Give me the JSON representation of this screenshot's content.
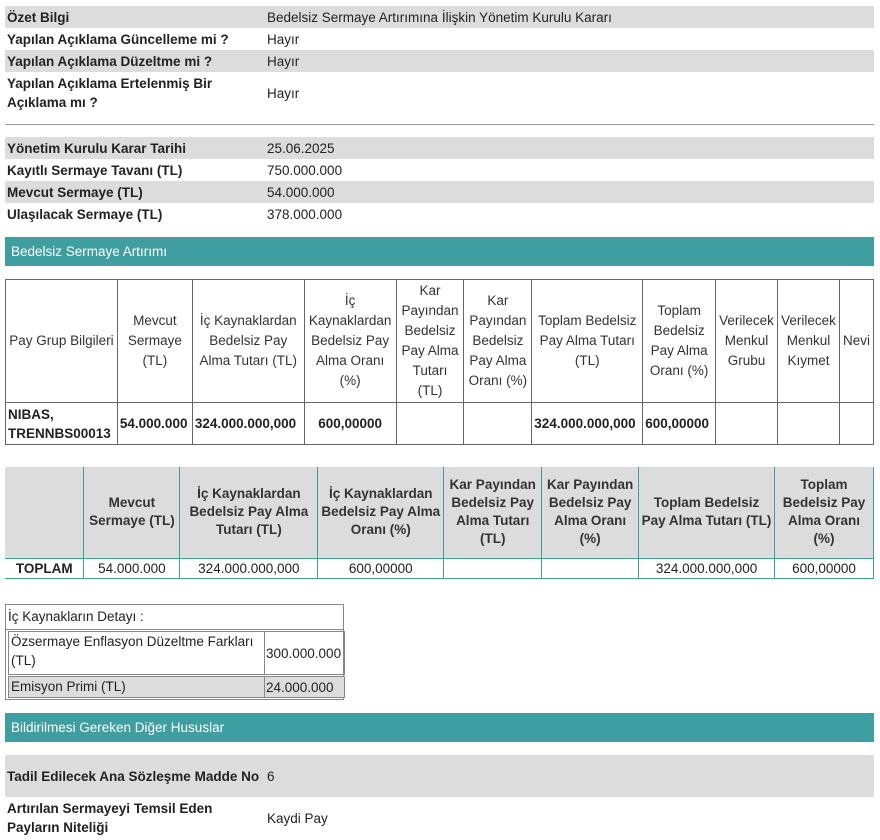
{
  "summary": [
    {
      "key": "Özet Bilgi",
      "value": "Bedelsiz Sermaye Artırımına İlişkin Yönetim Kurulu Kararı",
      "alt": true
    },
    {
      "key": "Yapılan Açıklama Güncelleme mi ?",
      "value": "Hayır",
      "alt": false
    },
    {
      "key": "Yapılan Açıklama Düzeltme mi ?",
      "value": "Hayır",
      "alt": true
    },
    {
      "key": "Yapılan Açıklama Ertelenmiş Bir Açıklama mı ?",
      "value": "Hayır",
      "alt": false
    }
  ],
  "board": [
    {
      "key": "Yönetim Kurulu Karar Tarihi",
      "value": "25.06.2025",
      "alt": true
    },
    {
      "key": "Kayıtlı Sermaye Tavanı (TL)",
      "value": "750.000.000",
      "alt": false
    },
    {
      "key": "Mevcut Sermaye (TL)",
      "value": "54.000.000",
      "alt": true
    },
    {
      "key": "Ulaşılacak Sermaye (TL)",
      "value": "378.000.000",
      "alt": false
    }
  ],
  "section1_title": "Bedelsiz Sermaye Artırımı",
  "table1": {
    "headers": [
      "Pay Grup Bilgileri",
      "Mevcut Sermaye (TL)",
      "İç Kaynaklardan Bedelsiz Pay Alma Tutarı (TL)",
      "İç Kaynaklardan Bedelsiz Pay Alma Oranı (%)",
      "Kar Payından Bedelsiz Pay Alma Tutarı (TL)",
      "Kar Payından Bedelsiz Pay Alma Oranı (%)",
      "Toplam Bedelsiz Pay Alma Tutarı (TL)",
      "Toplam Bedelsiz Pay Alma Oranı (%)",
      "Verilecek Menkul Grubu",
      "Verilecek Menkul Kıymet",
      "Nevi"
    ],
    "row": [
      "NIBAS, TRENNBS00013",
      "54.000.000",
      "324.000.000,000",
      "600,00000",
      "",
      "",
      "324.000.000,000",
      "600,00000",
      "",
      "",
      ""
    ]
  },
  "table2": {
    "headers": [
      "",
      "Mevcut Sermaye (TL)",
      "İç Kaynaklardan Bedelsiz Pay Alma Tutarı (TL)",
      "İç Kaynaklardan Bedelsiz Pay Alma Oranı (%)",
      "Kar Payından Bedelsiz Pay Alma Tutarı (TL)",
      "Kar Payından Bedelsiz Pay Alma Oranı (%)",
      "Toplam Bedelsiz Pay Alma Tutarı (TL)",
      "Toplam Bedelsiz Pay Alma Oranı (%)"
    ],
    "row": [
      "TOPLAM",
      "54.000.000",
      "324.000.000,000",
      "600,00000",
      "",
      "",
      "324.000.000,000",
      "600,00000"
    ]
  },
  "internal_sources": {
    "title": "İç Kaynakların Detayı :",
    "rows": [
      {
        "label": "Özsermaye Enflasyon Düzeltme Farkları (TL)",
        "value": "300.000.000"
      },
      {
        "label": "Emisyon Primi (TL)",
        "value": "24.000.000"
      }
    ]
  },
  "section2_title": "Bildirilmesi Gereken Diğer Hususlar",
  "other": [
    {
      "key": "Tadil Edilecek Ana Sözleşme Madde No",
      "value": "6",
      "alt": true
    },
    {
      "key": "Artırılan Sermayeyi Temsil Eden Payların Niteliği",
      "value": "Kaydi Pay",
      "alt": false
    }
  ],
  "colors": {
    "accent": "#3e9ea0",
    "stripe": "#dcdcdc"
  }
}
